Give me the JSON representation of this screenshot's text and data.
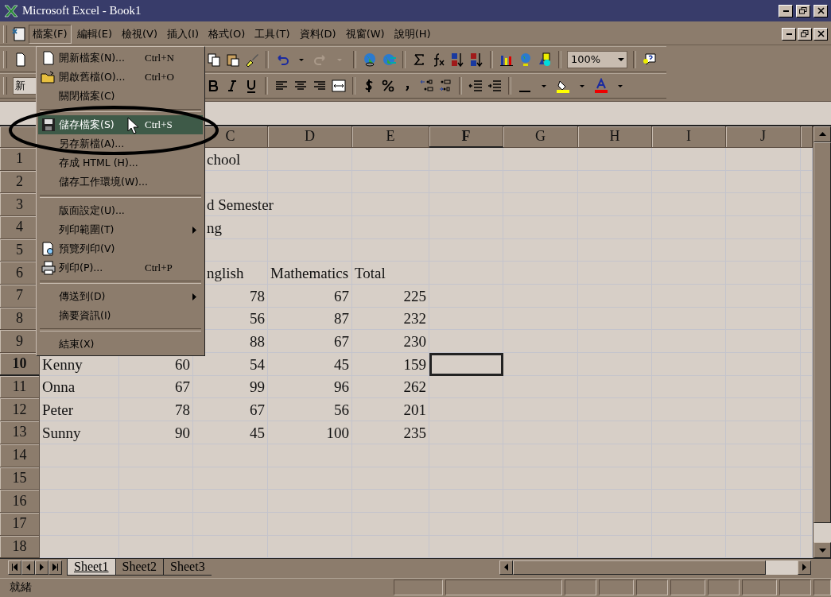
{
  "window": {
    "title": "Microsoft Excel - Book1"
  },
  "menu_bar": {
    "items": [
      {
        "label": "檔案(F)",
        "selected": true
      },
      {
        "label": "編輯(E)",
        "selected": false
      },
      {
        "label": "檢視(V)",
        "selected": false
      },
      {
        "label": "插入(I)",
        "selected": false
      },
      {
        "label": "格式(O)",
        "selected": false
      },
      {
        "label": "工具(T)",
        "selected": false
      },
      {
        "label": "資料(D)",
        "selected": false
      },
      {
        "label": "視窗(W)",
        "selected": false
      },
      {
        "label": "說明(H)",
        "selected": false
      }
    ]
  },
  "toolbar": {
    "zoom": "100%"
  },
  "format_toolbar": {
    "font": "新"
  },
  "columns": [
    {
      "label": "C",
      "selected": false
    },
    {
      "label": "D",
      "selected": false
    },
    {
      "label": "E",
      "selected": false
    },
    {
      "label": "F",
      "selected": true
    },
    {
      "label": "G",
      "selected": false
    },
    {
      "label": "H",
      "selected": false
    },
    {
      "label": "I",
      "selected": false
    },
    {
      "label": "J",
      "selected": false
    }
  ],
  "rows": [
    {
      "number": "1",
      "selected": false,
      "cells": [
        {
          "kind": "blank"
        },
        {
          "kind": "blank"
        },
        {
          "text": "chool",
          "kind": "text"
        }
      ]
    },
    {
      "number": "2",
      "selected": false
    },
    {
      "number": "3",
      "selected": false,
      "cells": [
        {
          "kind": "blank"
        },
        {
          "kind": "blank"
        },
        {
          "text": "d Semester",
          "kind": "text"
        }
      ]
    },
    {
      "number": "4",
      "selected": false,
      "cells": [
        {
          "kind": "blank"
        },
        {
          "kind": "blank"
        },
        {
          "text": "ng",
          "kind": "text"
        }
      ]
    },
    {
      "number": "5",
      "selected": false
    },
    {
      "number": "6",
      "selected": false,
      "cells": [
        {
          "kind": "blank"
        },
        {
          "kind": "blank"
        },
        {
          "text": "nglish",
          "kind": "text"
        },
        {
          "text": "Mathematics",
          "kind": "text"
        },
        {
          "text": "Total",
          "kind": "text"
        }
      ]
    },
    {
      "number": "7",
      "selected": false,
      "cells": [
        {
          "kind": "blank"
        },
        {
          "kind": "blank"
        },
        {
          "text": "78",
          "kind": "number"
        },
        {
          "text": "67",
          "kind": "number"
        },
        {
          "text": "225",
          "kind": "number"
        }
      ]
    },
    {
      "number": "8",
      "selected": false,
      "cells": [
        {
          "kind": "blank"
        },
        {
          "kind": "blank"
        },
        {
          "text": "56",
          "kind": "number"
        },
        {
          "text": "87",
          "kind": "number"
        },
        {
          "text": "232",
          "kind": "number"
        }
      ]
    },
    {
      "number": "9",
      "selected": false,
      "cells": [
        {
          "kind": "blank"
        },
        {
          "kind": "blank"
        },
        {
          "text": "88",
          "kind": "number"
        },
        {
          "text": "67",
          "kind": "number"
        },
        {
          "text": "230",
          "kind": "number"
        }
      ]
    },
    {
      "number": "10",
      "selected": true,
      "cells": [
        {
          "text": "Kenny",
          "kind": "text"
        },
        {
          "text": "60",
          "kind": "number"
        },
        {
          "text": "54",
          "kind": "number"
        },
        {
          "text": "45",
          "kind": "number"
        },
        {
          "text": "159",
          "kind": "number"
        }
      ]
    },
    {
      "number": "11",
      "selected": false,
      "cells": [
        {
          "text": "Onna",
          "kind": "text"
        },
        {
          "text": "67",
          "kind": "number"
        },
        {
          "text": "99",
          "kind": "number"
        },
        {
          "text": "96",
          "kind": "number"
        },
        {
          "text": "262",
          "kind": "number"
        }
      ]
    },
    {
      "number": "12",
      "selected": false,
      "cells": [
        {
          "text": "Peter",
          "kind": "text"
        },
        {
          "text": "78",
          "kind": "number"
        },
        {
          "text": "67",
          "kind": "number"
        },
        {
          "text": "56",
          "kind": "number"
        },
        {
          "text": "201",
          "kind": "number"
        }
      ]
    },
    {
      "number": "13",
      "selected": false,
      "cells": [
        {
          "text": "Sunny",
          "kind": "text"
        },
        {
          "text": "90",
          "kind": "number"
        },
        {
          "text": "45",
          "kind": "number"
        },
        {
          "text": "100",
          "kind": "number"
        },
        {
          "text": "235",
          "kind": "number"
        }
      ]
    },
    {
      "number": "14",
      "selected": false
    },
    {
      "number": "15",
      "selected": false
    },
    {
      "number": "16",
      "selected": false
    },
    {
      "number": "17",
      "selected": false
    },
    {
      "number": "18",
      "selected": false
    }
  ],
  "file_menu": {
    "items": [
      {
        "kind": "new",
        "label": "開新檔案(N)...",
        "shortcut": "Ctrl+N",
        "submenu": false,
        "selected": false
      },
      {
        "kind": "open",
        "label": "開啟舊檔(O)...",
        "shortcut": "Ctrl+O",
        "submenu": false,
        "selected": false
      },
      {
        "kind": "plain",
        "label": "關閉檔案(C)",
        "submenu": false,
        "selected": false
      },
      {
        "kind": "separator"
      },
      {
        "kind": "save",
        "label": "儲存檔案(S)",
        "shortcut": "Ctrl+S",
        "submenu": false,
        "selected": true
      },
      {
        "kind": "plain",
        "label": "另存新檔(A)...",
        "submenu": false,
        "selected": false
      },
      {
        "kind": "plain",
        "label": "存成 HTML (H)...",
        "submenu": false,
        "selected": false
      },
      {
        "kind": "plain",
        "label": "儲存工作環境(W)...",
        "submenu": false,
        "selected": false
      },
      {
        "kind": "separator"
      },
      {
        "kind": "plain",
        "label": "版面設定(U)...",
        "submenu": false,
        "selected": false
      },
      {
        "kind": "plain",
        "label": "列印範圍(T)",
        "submenu": true,
        "selected": false
      },
      {
        "kind": "preview",
        "label": "預覽列印(V)",
        "submenu": false,
        "selected": false
      },
      {
        "kind": "print",
        "label": "列印(P)...",
        "shortcut": "Ctrl+P",
        "submenu": false,
        "selected": false
      },
      {
        "kind": "separator"
      },
      {
        "kind": "plain",
        "label": "傳送到(D)",
        "submenu": true,
        "selected": false
      },
      {
        "kind": "plain",
        "label": "摘要資訊(I)",
        "submenu": false,
        "selected": false
      },
      {
        "kind": "separator"
      },
      {
        "kind": "plain",
        "label": "結束(X)",
        "submenu": false,
        "selected": false
      }
    ]
  },
  "sheet_tabs": [
    {
      "label": "Sheet1",
      "selected": true
    },
    {
      "label": "Sheet2",
      "selected": false
    },
    {
      "label": "Sheet3",
      "selected": false
    }
  ],
  "status_bar": {
    "text": "就緒"
  }
}
